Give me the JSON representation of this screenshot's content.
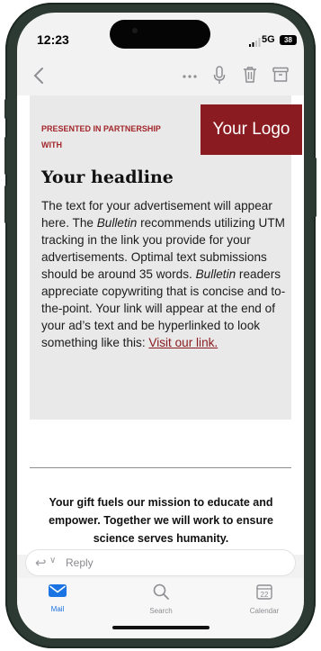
{
  "status_bar": {
    "time": "12:23",
    "network": "5G",
    "battery": "38"
  },
  "ad": {
    "partner_label": "PRESENTED IN PARTNERSHIP WITH",
    "logo_text": "Your Logo",
    "headline": "Your headline",
    "body_parts": [
      "The text for your advertisement will appear here. The ",
      "Bulletin",
      " recommends utilizing UTM tracking in the link you provide for your advertisements. Optimal text submissions should be around 35 words. ",
      "Bulletin",
      " readers appreciate copywriting that is concise and to-the-point. Your link will appear at the end of your ad’s text and be hyperlinked to look something like this: "
    ],
    "link_text": "Visit our link."
  },
  "mission_text": "Your gift fuels our mission to educate and empower. Together we will work to ensure science serves humanity.",
  "reply": {
    "label": "Reply"
  },
  "tabs": [
    {
      "label": "Mail",
      "active": true
    },
    {
      "label": "Search",
      "active": false
    },
    {
      "label": "Calendar",
      "active": false,
      "badge": "22"
    }
  ],
  "colors": {
    "brand_red": "#8a1c21",
    "tab_active": "#1b74e4",
    "tab_inactive": "#8e8e93"
  },
  "icons": [
    "back-chevron-icon",
    "more-icon",
    "microphone-icon",
    "trash-icon",
    "archive-icon",
    "reply-icon",
    "mail-icon",
    "search-icon",
    "calendar-icon"
  ]
}
